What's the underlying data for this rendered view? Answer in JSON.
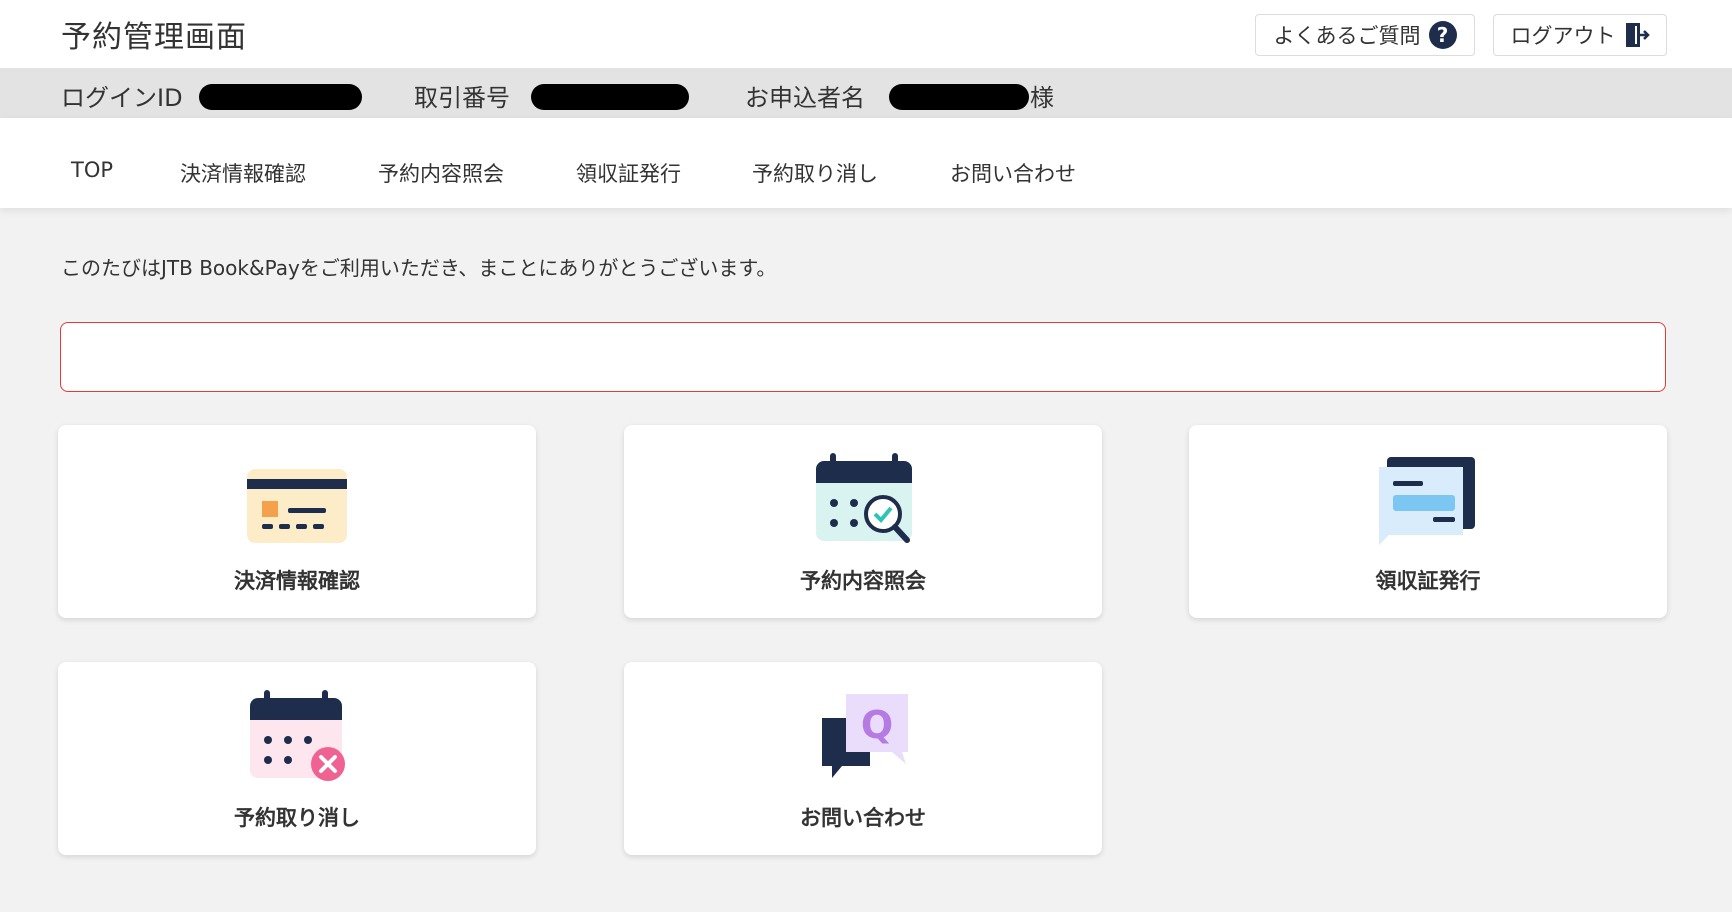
{
  "header": {
    "title": "予約管理画面",
    "faq_label": "よくあるご質問",
    "logout_label": "ログアウト"
  },
  "infobar": {
    "login_id_label": "ログインID",
    "transaction_label": "取引番号",
    "applicant_label": "お申込者名",
    "honorific": "様"
  },
  "nav": {
    "items": [
      "TOP",
      "決済情報確認",
      "予約内容照会",
      "領収証発行",
      "予約取り消し",
      "お問い合わせ"
    ]
  },
  "main": {
    "welcome": "このたびはJTB Book&Payをご利用いただき、まことにありがとうございます。",
    "cards": [
      {
        "label": "決済情報確認",
        "icon": "card-icon"
      },
      {
        "label": "予約内容照会",
        "icon": "calendar-search-icon"
      },
      {
        "label": "領収証発行",
        "icon": "receipt-icon"
      },
      {
        "label": "予約取り消し",
        "icon": "calendar-cancel-icon"
      },
      {
        "label": "お問い合わせ",
        "icon": "chat-q-icon"
      }
    ],
    "inquiry_icon_letter": "Q"
  },
  "colors": {
    "navy": "#1f2d4d",
    "alert_border": "#e53935",
    "cancel_pink": "#f06292"
  }
}
